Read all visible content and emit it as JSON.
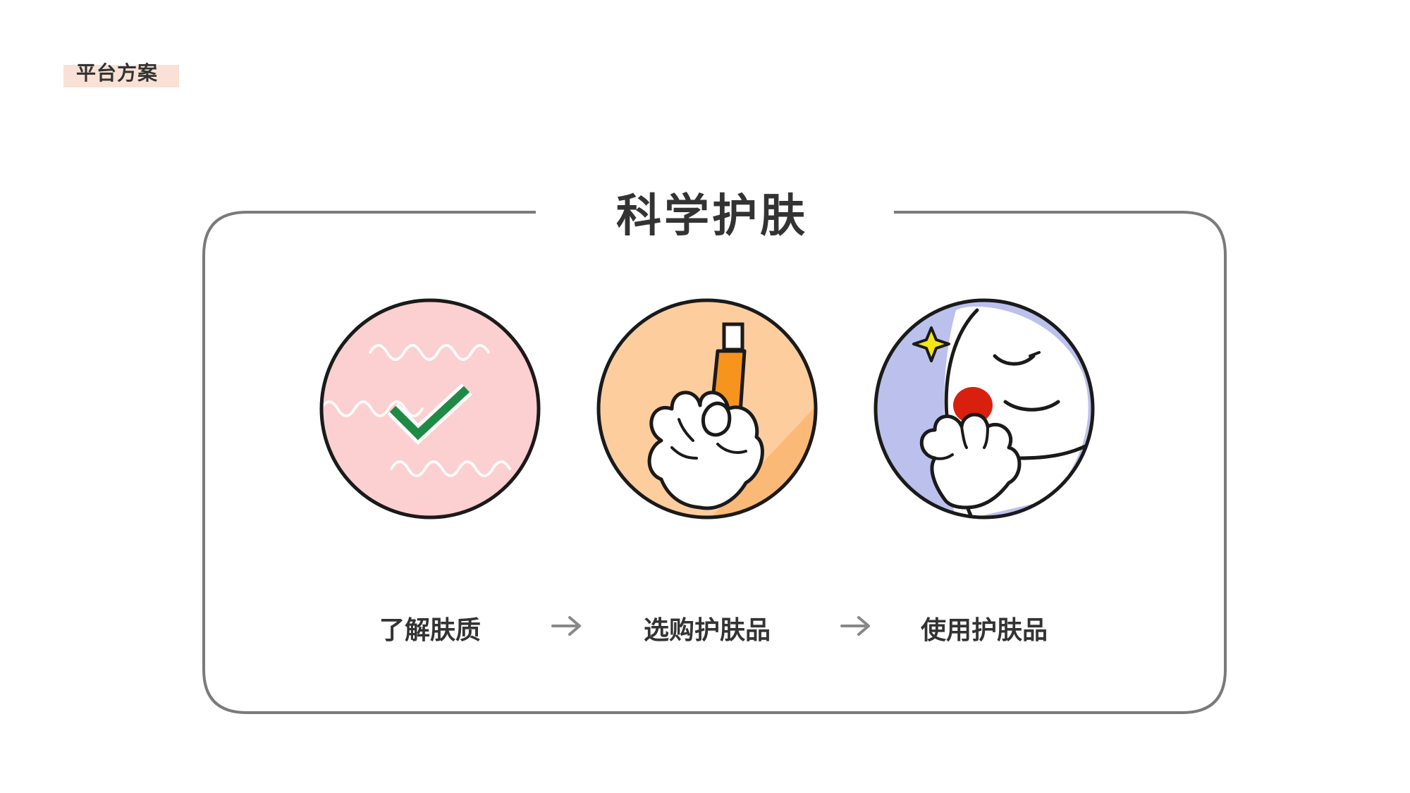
{
  "header": {
    "section_tag": "平台方案"
  },
  "main": {
    "title": "科学护肤",
    "steps": [
      {
        "label": "了解肤质",
        "icon": "checkmark-on-skin-icon"
      },
      {
        "label": "选购护肤品",
        "icon": "hand-holding-bottle-icon"
      },
      {
        "label": "使用护肤品",
        "icon": "face-applying-cream-icon"
      }
    ],
    "arrow_icon": "arrow-right-icon"
  },
  "colors": {
    "tag_bg": "#f9e1d6",
    "frame": "#7a7a7a",
    "text": "#333333",
    "pink": "#fccfd0",
    "orange_bg": "#fdcd9e",
    "orange_bottle": "#f7941d",
    "lavender": "#bcc0ec",
    "green_check": "#1f8a45",
    "red_cream": "#d9200f",
    "sparkle": "#f5e614"
  }
}
